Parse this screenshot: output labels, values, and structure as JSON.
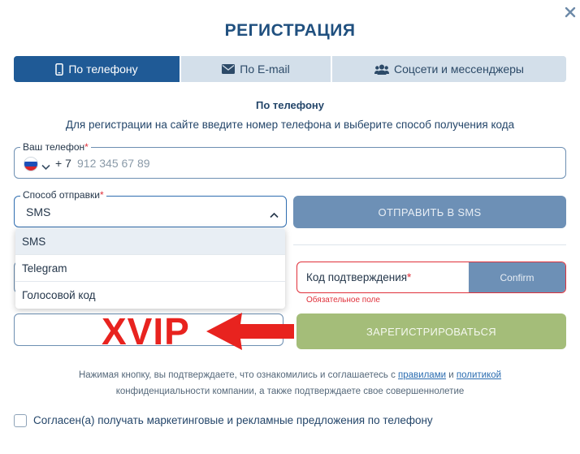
{
  "title": "РЕГИСТРАЦИЯ",
  "tabs": [
    {
      "label": "По телефону",
      "icon": "phone-icon",
      "active": true
    },
    {
      "label": "По E-mail",
      "icon": "envelope-icon",
      "active": false
    },
    {
      "label": "Соцсети и мессенджеры",
      "icon": "users-icon",
      "active": false
    }
  ],
  "section": {
    "subtitle": "По телефону",
    "description": "Для регистрации на сайте введите номер телефона и выберите способ получения кода"
  },
  "phone": {
    "label": "Ваш телефон",
    "required_mark": "*",
    "country_code": "+ 7",
    "placeholder": "912 345 67 89",
    "value": "",
    "flag_colors": [
      "#ffffff",
      "#1c4fb8",
      "#d8262c"
    ]
  },
  "send_method": {
    "label": "Способ отправки",
    "required_mark": "*",
    "selected": "SMS",
    "options": [
      "SMS",
      "Telegram",
      "Голосовой код"
    ]
  },
  "send_sms_button": "ОТПРАВИТЬ В SMS",
  "confirmation": {
    "label": "Код подтверждения",
    "required_mark": "*",
    "confirm_button": "Confirm",
    "error": "Обязательное поле"
  },
  "overlay": {
    "text": "XVIP",
    "color": "#e8231f"
  },
  "register_button": "ЗАРЕГИСТРИРОВАТЬСЯ",
  "terms": {
    "prefix": "Нажимая кнопку, вы подтверждаете, что ознакомились и соглашаетесь с",
    "link_rules": "правилами",
    "and": "и",
    "link_policy": "политикой",
    "suffix": "конфиденциальности компании, а также подтверждаете свое совершеннолетие"
  },
  "consent": {
    "label": "Согласен(а) получать маркетинговые и рекламные предложения по телефону",
    "checked": false
  },
  "colors": {
    "accent": "#1f5a96",
    "tab_bg": "#d3dfea",
    "disabled_button": "#6d90b6",
    "register_button": "#a4bd79",
    "error": "#e0303a"
  }
}
